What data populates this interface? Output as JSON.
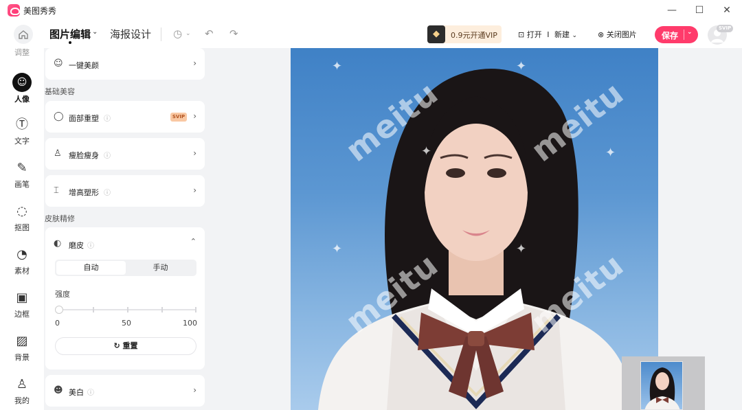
{
  "app": {
    "title": "美图秀秀"
  },
  "window": {
    "minimize": "—",
    "maximize": "☐",
    "close": "✕"
  },
  "toolbar": {
    "tab_edit": "图片编辑",
    "tab_poster": "海报设计",
    "vip_text": "0.9元开通VIP",
    "open_label": "打开",
    "divider": "I",
    "new_label": "新建",
    "close_image_label": "关闭图片",
    "save_label": "保存",
    "svip_tag": "SVIP"
  },
  "rail": {
    "items": [
      {
        "label": "调整",
        "icon": "adjust-icon"
      },
      {
        "label": "人像",
        "icon": "portrait-icon"
      },
      {
        "label": "文字",
        "icon": "text-icon"
      },
      {
        "label": "画笔",
        "icon": "brush-icon"
      },
      {
        "label": "抠图",
        "icon": "cutout-icon"
      },
      {
        "label": "素材",
        "icon": "sticker-icon"
      },
      {
        "label": "边框",
        "icon": "frame-icon"
      },
      {
        "label": "背景",
        "icon": "background-icon"
      },
      {
        "label": "我的",
        "icon": "user-icon"
      }
    ]
  },
  "panel": {
    "one_click": "一键美颜",
    "section_basic": "基础美容",
    "face_reshape": "面部重塑",
    "svip_badge": "SVIP",
    "slim": "瘦脸瘦身",
    "height": "增高塑形",
    "section_skin": "皮肤精修",
    "smooth": {
      "title": "磨皮",
      "mode_auto": "自动",
      "mode_manual": "手动",
      "active_mode": "自动",
      "strength_label": "强度",
      "min": "0",
      "mid": "50",
      "max": "100",
      "value": 0,
      "reset": "重置"
    },
    "whiten": "美白"
  },
  "canvas": {
    "watermark": "meitu"
  },
  "colors": {
    "accent": "#ff3b6b",
    "photo_bg": "#4f8bcb"
  }
}
